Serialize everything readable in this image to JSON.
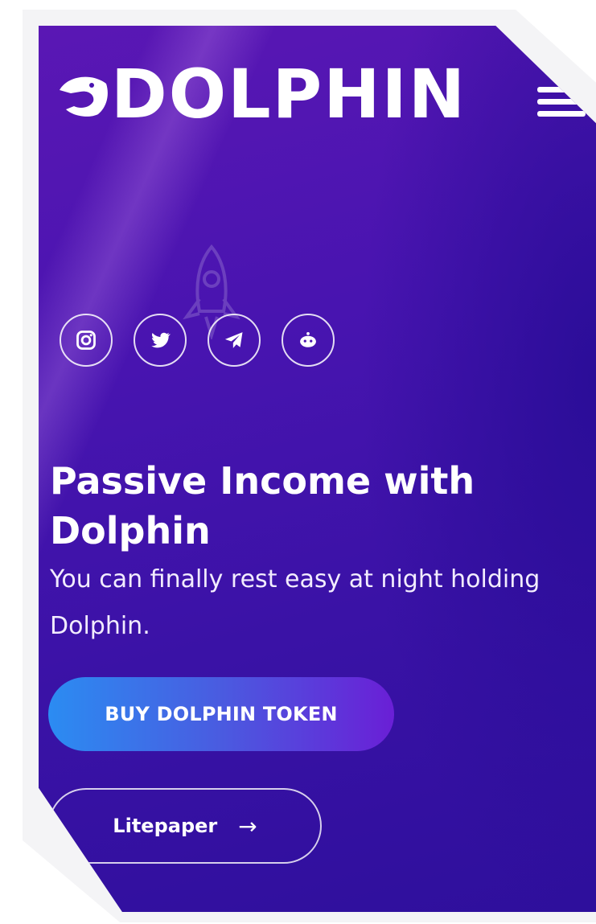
{
  "brand": {
    "logo_text": "DOLPHIN"
  },
  "socials": [
    {
      "name": "instagram-icon"
    },
    {
      "name": "twitter-icon"
    },
    {
      "name": "telegram-icon"
    },
    {
      "name": "reddit-icon"
    }
  ],
  "hero": {
    "headline": "Passive Income with Dolphin",
    "subtext": "You can finally rest easy at night holding Dolphin."
  },
  "buttons": {
    "buy_label": "BUY DOLPHIN TOKEN",
    "litepaper_label": "Litepaper",
    "litepaper_arrow": "→"
  },
  "colors": {
    "background_top": "#5a17b4",
    "background_bottom": "#2e0f9c",
    "buy_gradient_start": "#2b8cf2",
    "buy_gradient_end": "#6a1fd6",
    "text": "#ffffff"
  }
}
